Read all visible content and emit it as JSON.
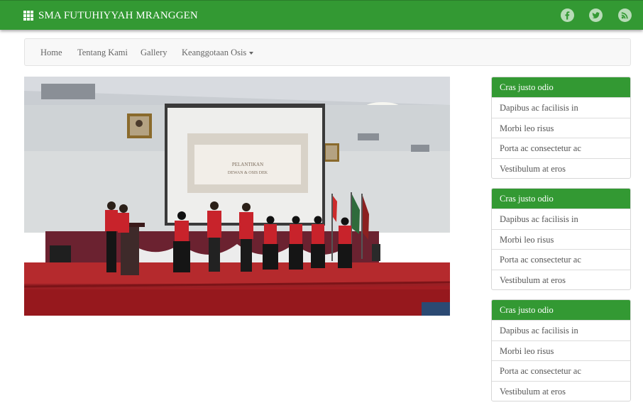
{
  "header": {
    "brand": "SMA FUTUHIYYAH MRANGGEN",
    "brand_icon": "grid-icon",
    "social_icons": [
      "facebook-icon",
      "twitter-icon",
      "rss-icon"
    ],
    "color": "#339933"
  },
  "nav": {
    "items": [
      {
        "label": "Home"
      },
      {
        "label": "Tentang Kami"
      },
      {
        "label": "Gallery"
      },
      {
        "label": "Keanggotaan Osis",
        "dropdown": true
      }
    ]
  },
  "main": {
    "photo_screen_text": [
      "PELANTIKAN",
      "DEWAN & OSIS DEK"
    ]
  },
  "sidebar": {
    "panels": [
      {
        "title": "Cras justo odio",
        "items": [
          "Dapibus ac facilisis in",
          "Morbi leo risus",
          "Porta ac consectetur ac",
          "Vestibulum at eros"
        ]
      },
      {
        "title": "Cras justo odio",
        "items": [
          "Dapibus ac facilisis in",
          "Morbi leo risus",
          "Porta ac consectetur ac",
          "Vestibulum at eros"
        ]
      },
      {
        "title": "Cras justo odio",
        "items": [
          "Dapibus ac facilisis in",
          "Morbi leo risus",
          "Porta ac consectetur ac",
          "Vestibulum at eros"
        ]
      }
    ]
  }
}
